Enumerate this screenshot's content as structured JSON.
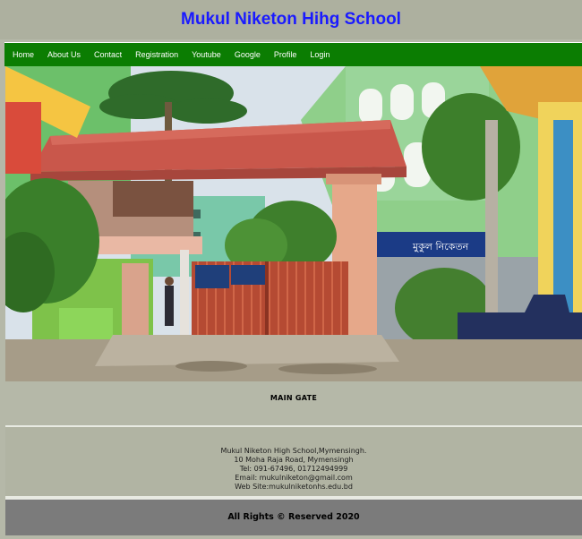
{
  "site": {
    "title": "Mukul Niketon Hihg School"
  },
  "nav": {
    "items": [
      "Home",
      "About Us",
      "Contact",
      "Registration",
      "Youtube",
      "Google",
      "Profile",
      "Login"
    ]
  },
  "photo": {
    "caption": "MAIN GATE",
    "sign_text": "মুকুল নিকেতন"
  },
  "address": {
    "line1": "Mukul Niketon High School,Mymensingh.",
    "line2": "10 Moha Raja Road, Mymensingh",
    "line3": "Tel: 091-67496, 01712494999",
    "line4": "Email: mukulniketon@gmail.com",
    "line5": "Web Site:mukulniketonhs.edu.bd"
  },
  "footer": {
    "text": "All Rights © Reserved 2020"
  },
  "colors": {
    "title": "#1a1aff",
    "nav_bg": "#0b7d02",
    "page_bg": "#b5b8a8",
    "footer_bg": "#7b7b7b"
  }
}
